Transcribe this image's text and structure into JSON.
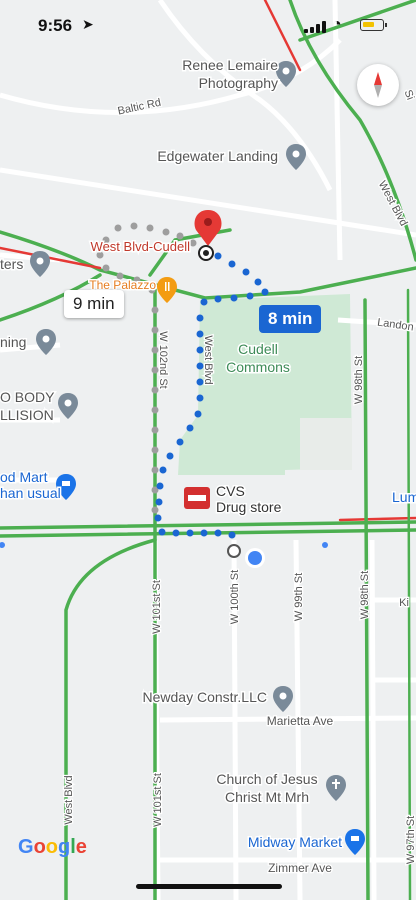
{
  "status_bar": {
    "time": "9:56",
    "location_icon": "location-arrow-icon",
    "signal_icon": "signal-icon",
    "wifi_icon": "wifi-icon",
    "battery_icon": "battery-icon",
    "battery_color": "#f2c200"
  },
  "map": {
    "places": [
      {
        "id": "renee",
        "text": [
          "Renee Lemaire",
          "Photography"
        ],
        "color": "#555555",
        "icon": "pin-icon"
      },
      {
        "id": "edgewater",
        "text": [
          "Edgewater Landing"
        ],
        "color": "#555555",
        "icon": "pin-icon"
      },
      {
        "id": "westblvd_cudell",
        "text": [
          "West Blvd-Cudell"
        ],
        "color": "#c0392b",
        "icon": "destination-pin-icon"
      },
      {
        "id": "palazzo",
        "text": [
          "The Palazzo"
        ],
        "color": "#e67e22",
        "icon": "restaurant-icon"
      },
      {
        "id": "ters",
        "text": [
          "ters"
        ],
        "color": "#555555",
        "icon": "pin-icon"
      },
      {
        "id": "ning",
        "text": [
          "ning"
        ],
        "color": "#555555",
        "icon": "pin-icon"
      },
      {
        "id": "bodycollision",
        "text": [
          "O BODY",
          "LLISION"
        ],
        "color": "#555555",
        "icon": "pin-icon"
      },
      {
        "id": "foodmart",
        "text": [
          "od Mart",
          "han usual"
        ],
        "color": "#1a66d2",
        "icon": "shopping-cart-icon"
      },
      {
        "id": "cudell_commons",
        "text": [
          "Cudell",
          "Commons"
        ],
        "color": "#3d8b57",
        "icon": ""
      },
      {
        "id": "cvs",
        "text": [
          "CVS",
          "Drug store"
        ],
        "color": "#333333",
        "icon": "cvs-logo-icon"
      },
      {
        "id": "newday",
        "text": [
          "Newday Constr.LLC"
        ],
        "color": "#555555",
        "icon": "pin-icon"
      },
      {
        "id": "church",
        "text": [
          "Church of Jesus",
          "Christ Mt Mrh"
        ],
        "color": "#555555",
        "icon": "cross-icon"
      },
      {
        "id": "midway",
        "text": [
          "Midway Market"
        ],
        "color": "#1a66d2",
        "icon": "shopping-cart-icon"
      },
      {
        "id": "lum",
        "text": [
          "Lum"
        ],
        "color": "#1a66d2",
        "icon": ""
      }
    ],
    "streets": [
      {
        "id": "baltic",
        "text": "Baltic Rd"
      },
      {
        "id": "westblvd_ne",
        "text": "West Blvd"
      },
      {
        "id": "si",
        "text": "Si"
      },
      {
        "id": "landon",
        "text": "Landon"
      },
      {
        "id": "w102",
        "text": "W 102nd St"
      },
      {
        "id": "westblvd_v",
        "text": "West Blvd"
      },
      {
        "id": "w98a",
        "text": "W 98th St"
      },
      {
        "id": "w99",
        "text": "W 99th St"
      },
      {
        "id": "w100",
        "text": "W 100th St"
      },
      {
        "id": "w101",
        "text": "W 101st St"
      },
      {
        "id": "w98b",
        "text": "W 98th St"
      },
      {
        "id": "ki",
        "text": "Ki"
      },
      {
        "id": "marietta",
        "text": "Marietta Ave"
      },
      {
        "id": "westblvd_s",
        "text": "West Blvd"
      },
      {
        "id": "w101b",
        "text": "W 101st St"
      },
      {
        "id": "zimmer",
        "text": "Zimmer Ave"
      },
      {
        "id": "w97",
        "text": "W 97th St"
      }
    ],
    "route_main": {
      "duration": "8 min",
      "color": "#1a66d2",
      "style": "dotted"
    },
    "route_alt": {
      "duration": "9 min",
      "color": "#9e9e9e",
      "style": "dotted"
    },
    "traffic_colors": {
      "free": "#4caf50",
      "slow": "#f39c12",
      "heavy": "#e53935"
    },
    "compass_icon": "compass-icon",
    "logo": "Google"
  }
}
